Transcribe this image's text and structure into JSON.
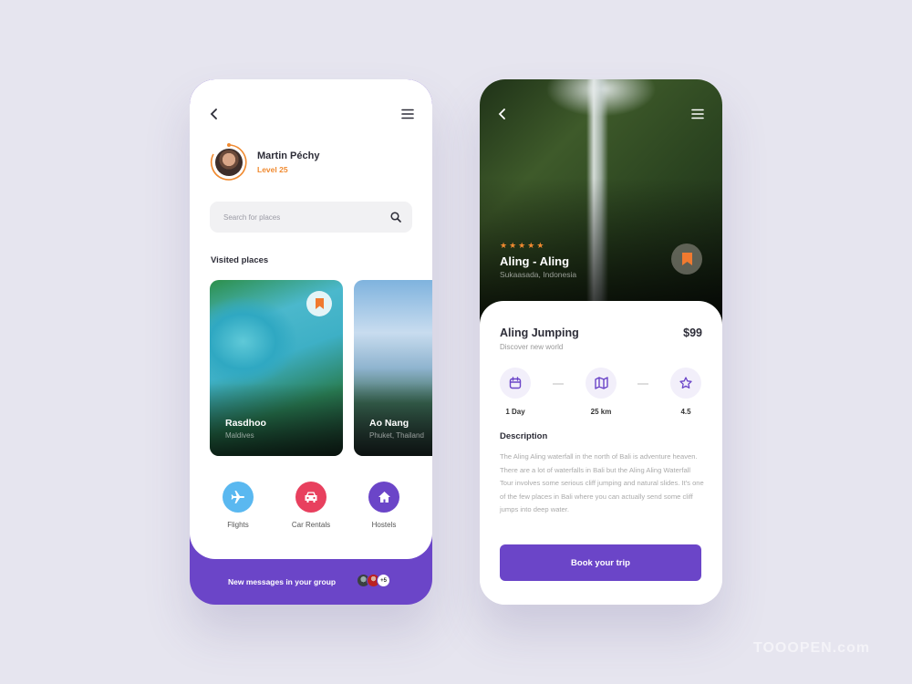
{
  "left_screen": {
    "user": {
      "name": "Martin Péchy",
      "level": "Level 25"
    },
    "search": {
      "placeholder": "Search for places"
    },
    "visited_title": "Visited places",
    "places": [
      {
        "name": "Rasdhoo",
        "location": "Maldives",
        "bookmarked": true
      },
      {
        "name": "Ao Nang",
        "location": "Phuket, Thailand",
        "bookmarked": false
      }
    ],
    "categories": [
      {
        "label": "Flights",
        "icon": "airplane-icon",
        "color": "#5ab8f0"
      },
      {
        "label": "Car Rentals",
        "icon": "car-icon",
        "color": "#e8405e"
      },
      {
        "label": "Hostels",
        "icon": "house-icon",
        "color": "#6b45c8"
      }
    ],
    "footer": {
      "message": "New messages in your group",
      "extra_count": "+5"
    }
  },
  "right_screen": {
    "rating_stars": 5,
    "place_title": "Aling - Aling",
    "place_location": "Sukaasada, Indonesia",
    "trip_title": "Aling Jumping",
    "trip_subtitle": "Discover new world",
    "price": "$99",
    "stats": [
      {
        "label": "1 Day",
        "icon": "calendar-icon"
      },
      {
        "label": "25 km",
        "icon": "map-icon"
      },
      {
        "label": "4.5",
        "icon": "star-icon"
      }
    ],
    "description_title": "Description",
    "description": "The Aling Aling waterfall in the north of Bali is adventure heaven. There are a lot of waterfalls in Bali but the Aling Aling Waterfall Tour involves some serious cliff jumping and natural slides. It's one of the few places in Bali where you can actually send some cliff jumps into deep water.",
    "cta_label": "Book your trip"
  },
  "colors": {
    "accent": "#6b45c8",
    "orange": "#f08a30",
    "background": "#e6e5ef"
  },
  "watermark": "TOOOPEN.com"
}
